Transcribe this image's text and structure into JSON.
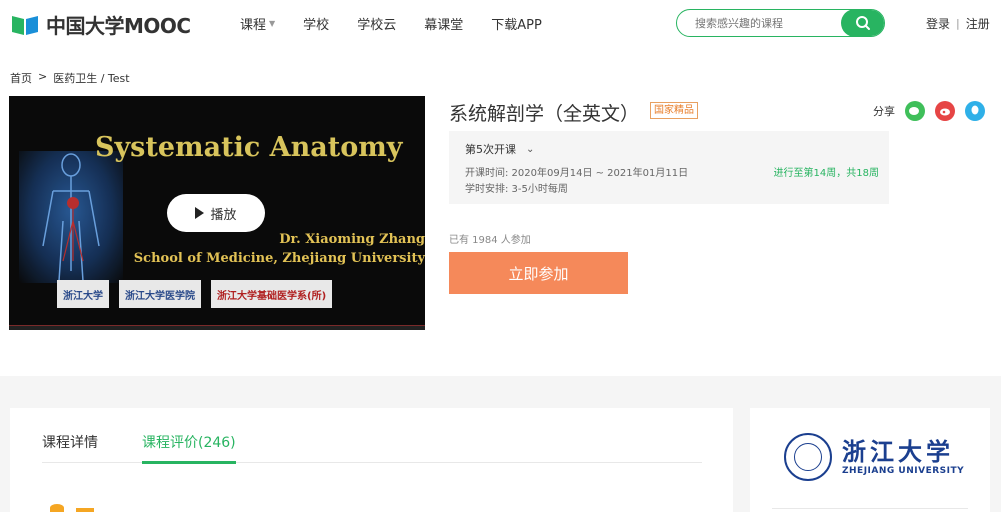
{
  "header": {
    "logo_text": "中国大学MOOC",
    "nav": [
      "课程",
      "学校",
      "学校云",
      "幕课堂",
      "下载APP"
    ],
    "search_placeholder": "搜索感兴趣的课程",
    "login": "登录",
    "register": "注册"
  },
  "breadcrumb": [
    "首页",
    ">",
    "医药卫生 / Test"
  ],
  "video": {
    "title": "Systematic Anatomy",
    "author_line1": "Dr. Xiaoming Zhang",
    "author_line2": "School of Medicine, Zhejiang University",
    "play_label": "播放",
    "badges": [
      "浙江大学",
      "浙江大学医学院",
      "浙江大学基础医学系(所)"
    ]
  },
  "course": {
    "title": "系统解剖学（全英文）",
    "tag": "国家精品",
    "share_label": "分享",
    "term": "第5次开课",
    "schedule_line": "开课时间:   2020年09月14日 ~ 2021年01月11日",
    "hours_line": "学时安排:   3-5小时每周",
    "progress": "进行至第14周，共18周",
    "enrolled": "已有 1984 人参加",
    "join_label": "立即参加"
  },
  "tabs": [
    {
      "label": "课程详情"
    },
    {
      "label": "课程评价(246)"
    }
  ],
  "university": {
    "name_cn": "浙江大学",
    "name_en": "ZHEJIANG UNIVERSITY"
  },
  "colors": {
    "brand_green": "#28b461",
    "join_orange": "#f5895a",
    "tag_orange": "#e87e2a",
    "univ_blue": "#1b3f8f"
  },
  "icons": [
    "search-icon",
    "wechat-icon",
    "weibo-icon",
    "qq-icon",
    "chevron-down-icon",
    "play-icon"
  ]
}
